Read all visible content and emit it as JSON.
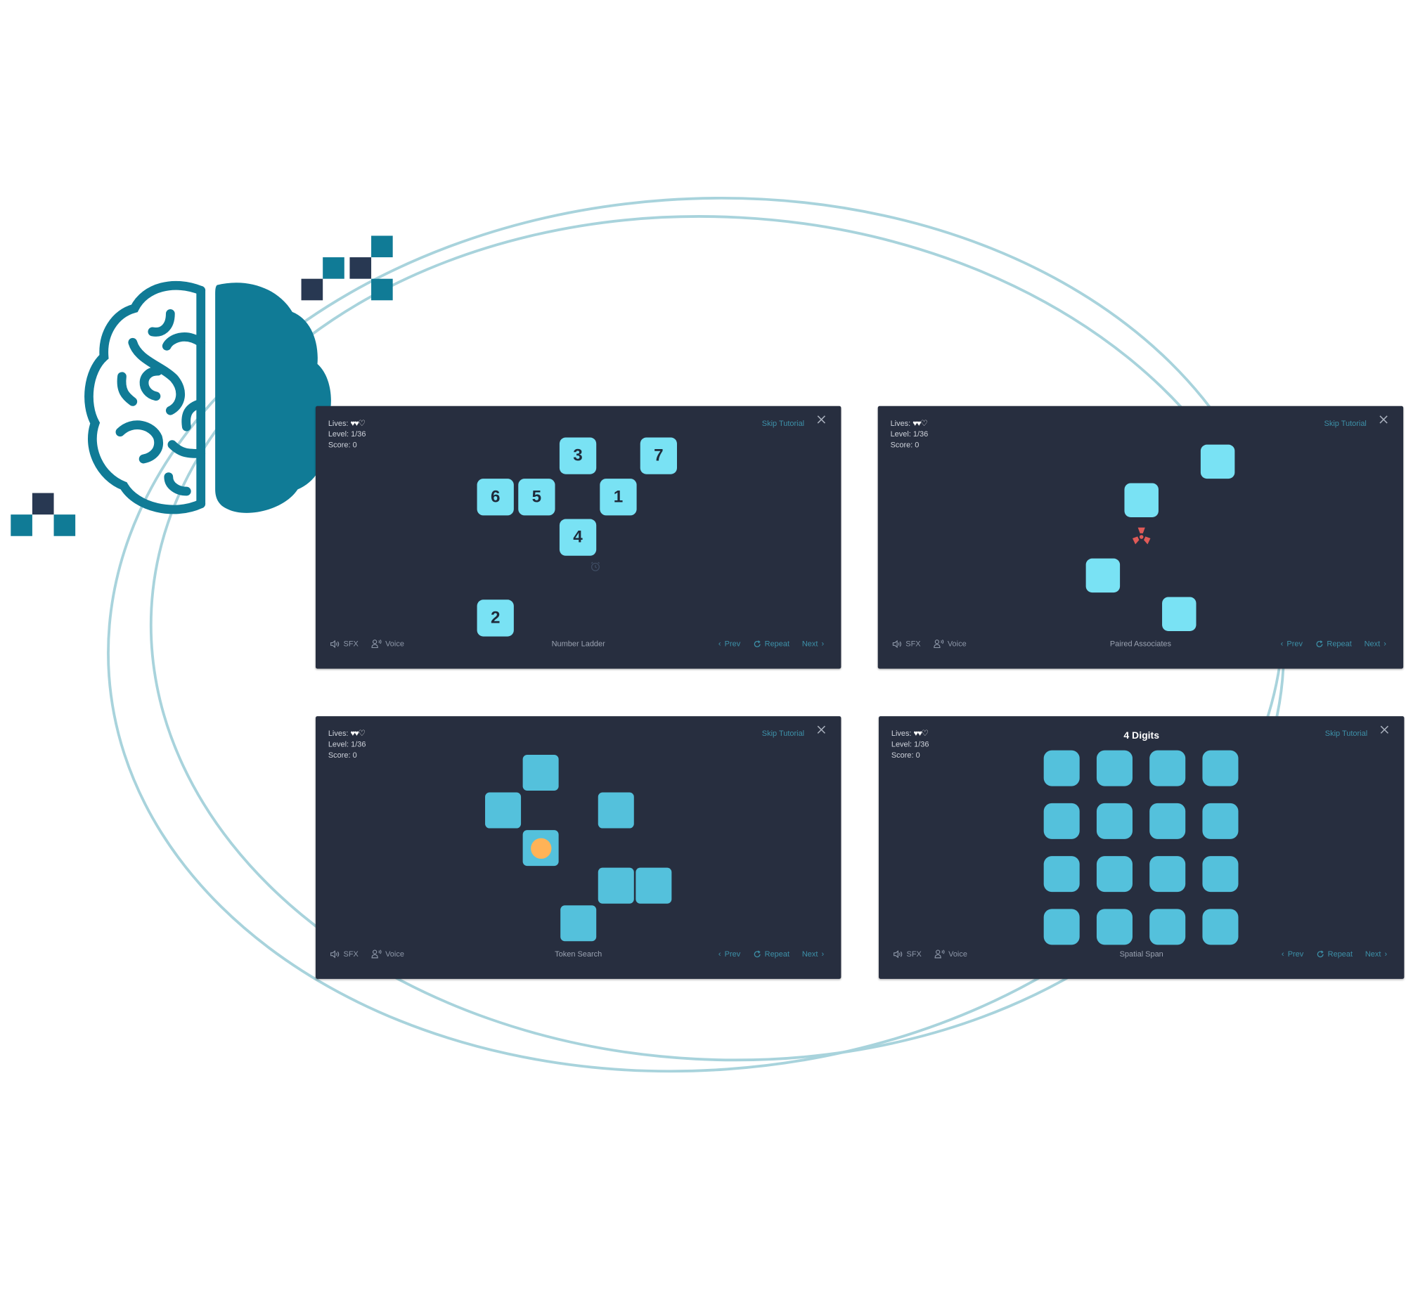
{
  "colors": {
    "brand_teal": "#107b96",
    "brand_dark": "#283852",
    "panel_bg": "#272e3f",
    "tile_light": "#79e2f4",
    "tile_mid": "#54c1dc",
    "accent_link": "#3d90a8",
    "hazard": "#e05a57",
    "token": "#ffb357",
    "ellipse": "#a8d3dc"
  },
  "decor": {
    "brain_icon": "brain-icon",
    "pixel_clusters": [
      "top-right-pixels",
      "left-pixels"
    ]
  },
  "common": {
    "lives_label": "Lives:",
    "lives_remaining": 2,
    "lives_total": 3,
    "hearts": "♥♥♡",
    "level_label": "Level:",
    "level_value": "1/36",
    "score_label": "Score:",
    "score_value": "0",
    "skip_label": "Skip Tutorial",
    "close_icon": "close-icon",
    "sfx_label": "SFX",
    "voice_label": "Voice",
    "prev_label": "Prev",
    "repeat_label": "Repeat",
    "next_label": "Next"
  },
  "panels": [
    {
      "game": "Number Ladder",
      "tiles": [
        "3",
        "7",
        "6",
        "5",
        "1",
        "4",
        "2"
      ],
      "timer_icon": "alarm-clock-icon"
    },
    {
      "game": "Paired Associates",
      "tile_count": 4,
      "center_icon": "radiation-icon"
    },
    {
      "game": "Token Search",
      "tile_count": 7,
      "token_icon": "token-dot"
    },
    {
      "game": "Spatial Span",
      "title": "4 Digits",
      "grid_rows": 4,
      "grid_cols": 4
    }
  ]
}
